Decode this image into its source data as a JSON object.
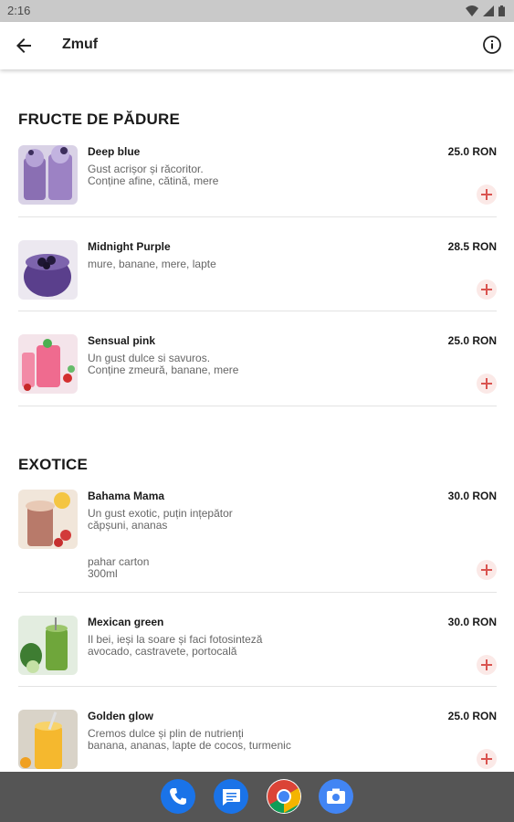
{
  "status_bar": {
    "time": "2:16"
  },
  "app_bar": {
    "title": "Zmuf"
  },
  "sections": [
    {
      "title": "FRUCTE DE PĂDURE",
      "items": [
        {
          "name": "Deep blue",
          "price": "25.0 RON",
          "desc": [
            "Gust acrișor și răcoritor.",
            "Conține afine, cătină, mere"
          ]
        },
        {
          "name": "Midnight Purple",
          "price": "28.5 RON",
          "desc": [
            "mure, banane, mere, lapte"
          ]
        },
        {
          "name": "Sensual pink",
          "price": "25.0 RON",
          "desc": [
            "Un gust dulce si savuros.",
            "Conține zmeură, banane, mere"
          ]
        }
      ]
    },
    {
      "title": "EXOTICE",
      "items": [
        {
          "name": "Bahama Mama",
          "price": "30.0 RON",
          "desc": [
            "Un gust exotic, puțin ințepător",
            "căpșuni, ananas"
          ],
          "extra": [
            "pahar carton",
            "300ml"
          ]
        },
        {
          "name": "Mexican green",
          "price": "30.0 RON",
          "desc": [
            "Il bei, ieși la soare și faci fotosinteză",
            "avocado, castravete, portocală"
          ]
        },
        {
          "name": "Golden glow",
          "price": "25.0 RON",
          "desc": [
            "Cremos dulce și plin de nutrienți",
            "banana, ananas, lapte de cocos, turmenic"
          ]
        }
      ]
    }
  ],
  "icons": {
    "back": "arrow-back-icon",
    "info": "info-icon",
    "add": "plus-icon",
    "dock": [
      "phone-icon",
      "messages-icon",
      "chrome-icon",
      "camera-icon"
    ]
  },
  "colors": {
    "accent": "#d9534f",
    "nav_bar": "#555555",
    "status_bar": "#c9c9c9"
  }
}
